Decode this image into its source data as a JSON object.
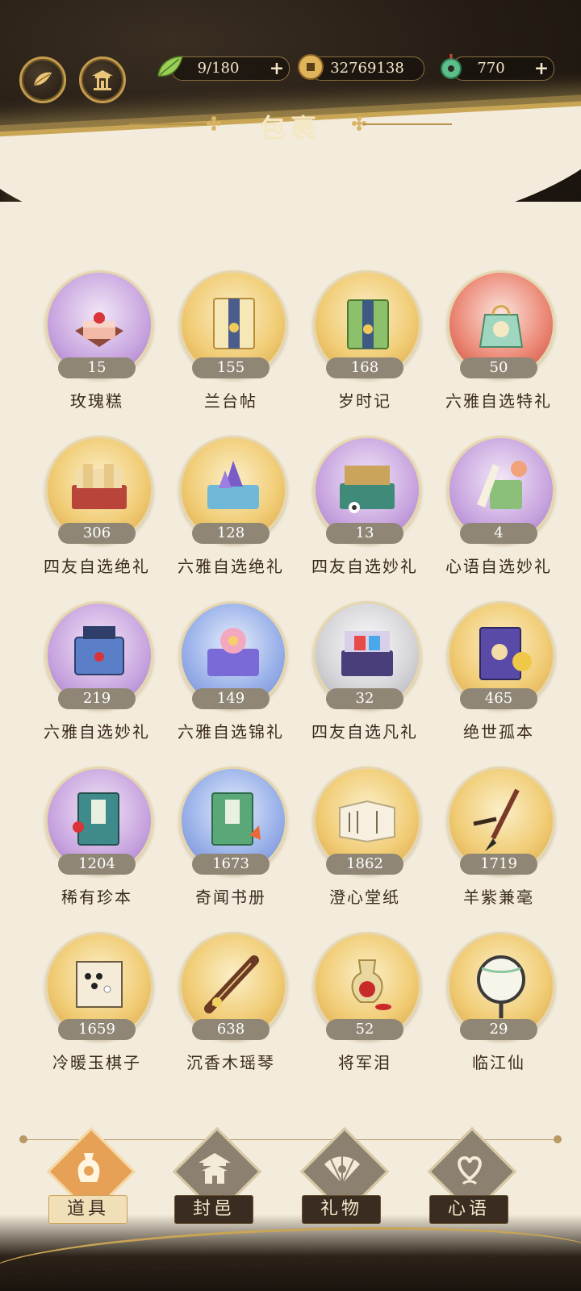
{
  "header": {
    "title": "包裹",
    "resources": [
      {
        "icon": "leaf-stamina-icon",
        "value": "9/180",
        "plus": "+"
      },
      {
        "icon": "copper-coin-icon",
        "value": "32769138",
        "plus": ""
      },
      {
        "icon": "jade-pendant-icon",
        "value": "770",
        "plus": "+"
      }
    ],
    "buttons": [
      {
        "icon": "leaf-emblem-icon"
      },
      {
        "icon": "pavilion-icon"
      }
    ]
  },
  "items": [
    {
      "name": "玫瑰糕",
      "count": "15",
      "bg": "purple",
      "icon": "rose-cake-icon"
    },
    {
      "name": "兰台帖",
      "count": "155",
      "bg": "gold",
      "icon": "invitation-card-icon"
    },
    {
      "name": "岁时记",
      "count": "168",
      "bg": "gold",
      "icon": "green-card-icon"
    },
    {
      "name": "六雅自选特礼",
      "count": "50",
      "bg": "red",
      "icon": "gift-bag-icon"
    },
    {
      "name": "四友自选绝礼",
      "count": "306",
      "bg": "gold",
      "icon": "scroll-box-icon"
    },
    {
      "name": "六雅自选绝礼",
      "count": "128",
      "bg": "gold",
      "icon": "crystal-box-icon"
    },
    {
      "name": "四友自选妙礼",
      "count": "13",
      "bg": "purple",
      "icon": "go-box-icon"
    },
    {
      "name": "心语自选妙礼",
      "count": "4",
      "bg": "purple",
      "icon": "jade-box-icon"
    },
    {
      "name": "六雅自选妙礼",
      "count": "219",
      "bg": "purple",
      "icon": "lantern-box-icon"
    },
    {
      "name": "六雅自选锦礼",
      "count": "149",
      "bg": "blue",
      "icon": "flower-box-icon"
    },
    {
      "name": "四友自选凡礼",
      "count": "32",
      "bg": "gray",
      "icon": "open-chest-icon"
    },
    {
      "name": "绝世孤本",
      "count": "465",
      "bg": "gold",
      "icon": "rare-book-icon"
    },
    {
      "name": "稀有珍本",
      "count": "1204",
      "bg": "purple",
      "icon": "teal-book-icon"
    },
    {
      "name": "奇闻书册",
      "count": "1673",
      "bg": "blue",
      "icon": "green-book-icon"
    },
    {
      "name": "澄心堂纸",
      "count": "1862",
      "bg": "gold",
      "icon": "paper-scroll-icon"
    },
    {
      "name": "羊紫兼毫",
      "count": "1719",
      "bg": "gold",
      "icon": "brush-icon"
    },
    {
      "name": "冷暖玉棋子",
      "count": "1659",
      "bg": "gold",
      "icon": "go-board-icon"
    },
    {
      "name": "沉香木瑶琴",
      "count": "638",
      "bg": "gold",
      "icon": "zither-icon"
    },
    {
      "name": "将军泪",
      "count": "52",
      "bg": "gold",
      "icon": "wine-flask-icon"
    },
    {
      "name": "临江仙",
      "count": "29",
      "bg": "gold",
      "icon": "round-fan-icon"
    }
  ],
  "tabs": [
    {
      "label": "道具",
      "icon": "vase-icon",
      "active": true
    },
    {
      "label": "封邑",
      "icon": "palace-icon",
      "active": false
    },
    {
      "label": "礼物",
      "icon": "folding-fan-icon",
      "active": false
    },
    {
      "label": "心语",
      "icon": "heart-knot-icon",
      "active": false
    }
  ],
  "colors": {
    "header_bg": "#241c14",
    "gold_accent": "#c9a656",
    "page_bg": "#f3ecdc",
    "count_pill": "#8f8676",
    "active_tab": "#e7a156"
  }
}
